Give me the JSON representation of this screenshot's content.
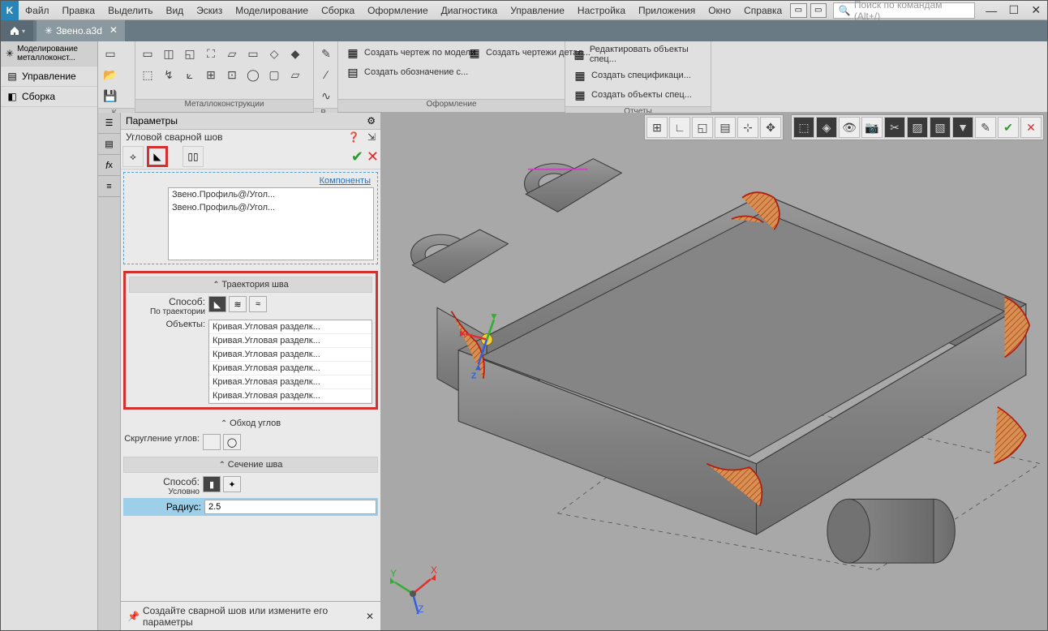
{
  "menu": {
    "items": [
      "Файл",
      "Правка",
      "Выделить",
      "Вид",
      "Эскиз",
      "Моделирование",
      "Сборка",
      "Оформление",
      "Диагностика",
      "Управление",
      "Настройка",
      "Приложения",
      "Окно",
      "Справка"
    ],
    "search_placeholder": "Поиск по командам (Alt+/)"
  },
  "tab": {
    "title": "Звено.a3d"
  },
  "left_modes": [
    {
      "label": "Моделирование металлоконст..."
    },
    {
      "label": "Управление"
    },
    {
      "label": "Сборка"
    }
  ],
  "ribbon": {
    "g1_label": "К..",
    "g2_label": "Металлоконструкции",
    "g3_label": "В..",
    "g4_label": "Оформление",
    "g5_label": "Отчеты",
    "create_drawing": "Создать чертеж по модели",
    "create_designation": "Создать обозначение с...",
    "create_detail_drawings": "Создать чертежи детал...",
    "edit_spec_objects": "Редактировать объекты спец...",
    "create_specification": "Создать спецификаци...",
    "create_spec_objects": "Создать объекты спец..."
  },
  "params": {
    "title": "Параметры",
    "subtitle": "Угловой сварной шов",
    "components": "Компоненты",
    "component_items": [
      "Звено.Профиль@/Угол...",
      "Звено.Профиль@/Угол..."
    ],
    "trajectory": {
      "title": "Траектория шва",
      "method_label": "Способ:",
      "method_sub": "По траектории",
      "objects_label": "Объекты:",
      "object_items": [
        "Кривая.Угловая разделк...",
        "Кривая.Угловая разделк...",
        "Кривая.Угловая разделк...",
        "Кривая.Угловая разделк...",
        "Кривая.Угловая разделк...",
        "Кривая.Угловая разделк..."
      ]
    },
    "corners": {
      "title": "Обход углов",
      "rounding_label": "Скругление углов:"
    },
    "section": {
      "title": "Сечение шва",
      "method_label": "Способ:",
      "method_sub": "Условно",
      "radius_label": "Радиус:",
      "radius_value": "2.5"
    }
  },
  "status": "Создайте сварной шов или измените его параметры",
  "axes": {
    "x": "X",
    "y": "Y",
    "z": "Z"
  }
}
